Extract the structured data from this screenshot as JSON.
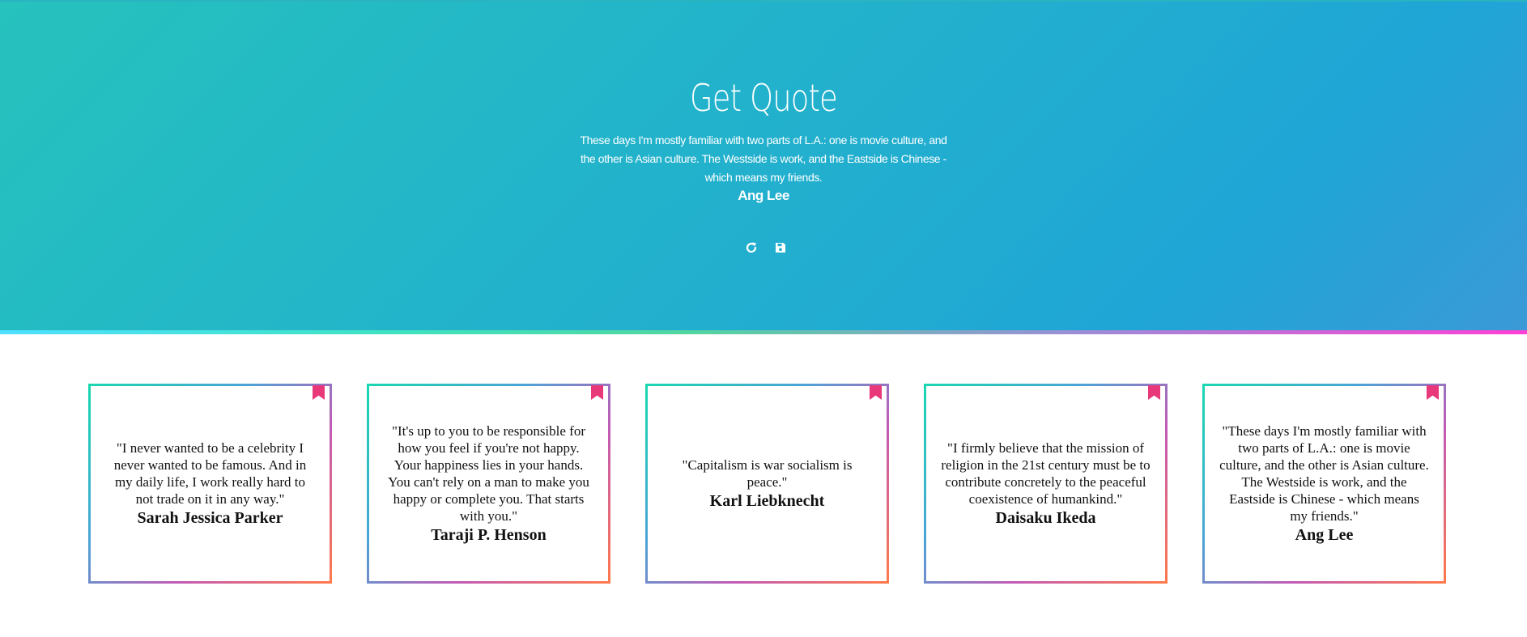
{
  "hero": {
    "title": "Get Quote",
    "quote": "These days I'm mostly familiar with two parts of L.A.: one is movie culture, and the other is Asian culture. The Westside is work, and the Eastside is Chinese - which means my friends.",
    "author": "Ang Lee",
    "actions": {
      "refresh_icon": "refresh-icon",
      "save_icon": "save-icon"
    }
  },
  "colors": {
    "hero_gradient_start": "#26c2bd",
    "hero_gradient_end": "#3a99d6",
    "bookmark": "#e8387a",
    "card_border_start": "#18d8b0",
    "card_border_end": "#ff7a4a"
  },
  "cards": [
    {
      "text": "\"I never wanted to be a celebrity I never wanted to be famous. And in my daily life, I work really hard to not trade on it in any way.\"",
      "author": "Sarah Jessica Parker"
    },
    {
      "text": "\"It's up to you to be responsible for how you feel if you're not happy. Your happiness lies in your hands. You can't rely on a man to make you happy or complete you. That starts with you.\"",
      "author": "Taraji P. Henson"
    },
    {
      "text": "\"Capitalism is war socialism is peace.\"",
      "author": "Karl Liebknecht"
    },
    {
      "text": "\"I firmly believe that the mission of religion in the 21st century must be to contribute concretely to the peaceful coexistence of humankind.\"",
      "author": "Daisaku Ikeda"
    },
    {
      "text": "\"These days I'm mostly familiar with two parts of L.A.: one is movie culture, and the other is Asian culture. The Westside is work, and the Eastside is Chinese - which means my friends.\"",
      "author": "Ang Lee"
    }
  ]
}
